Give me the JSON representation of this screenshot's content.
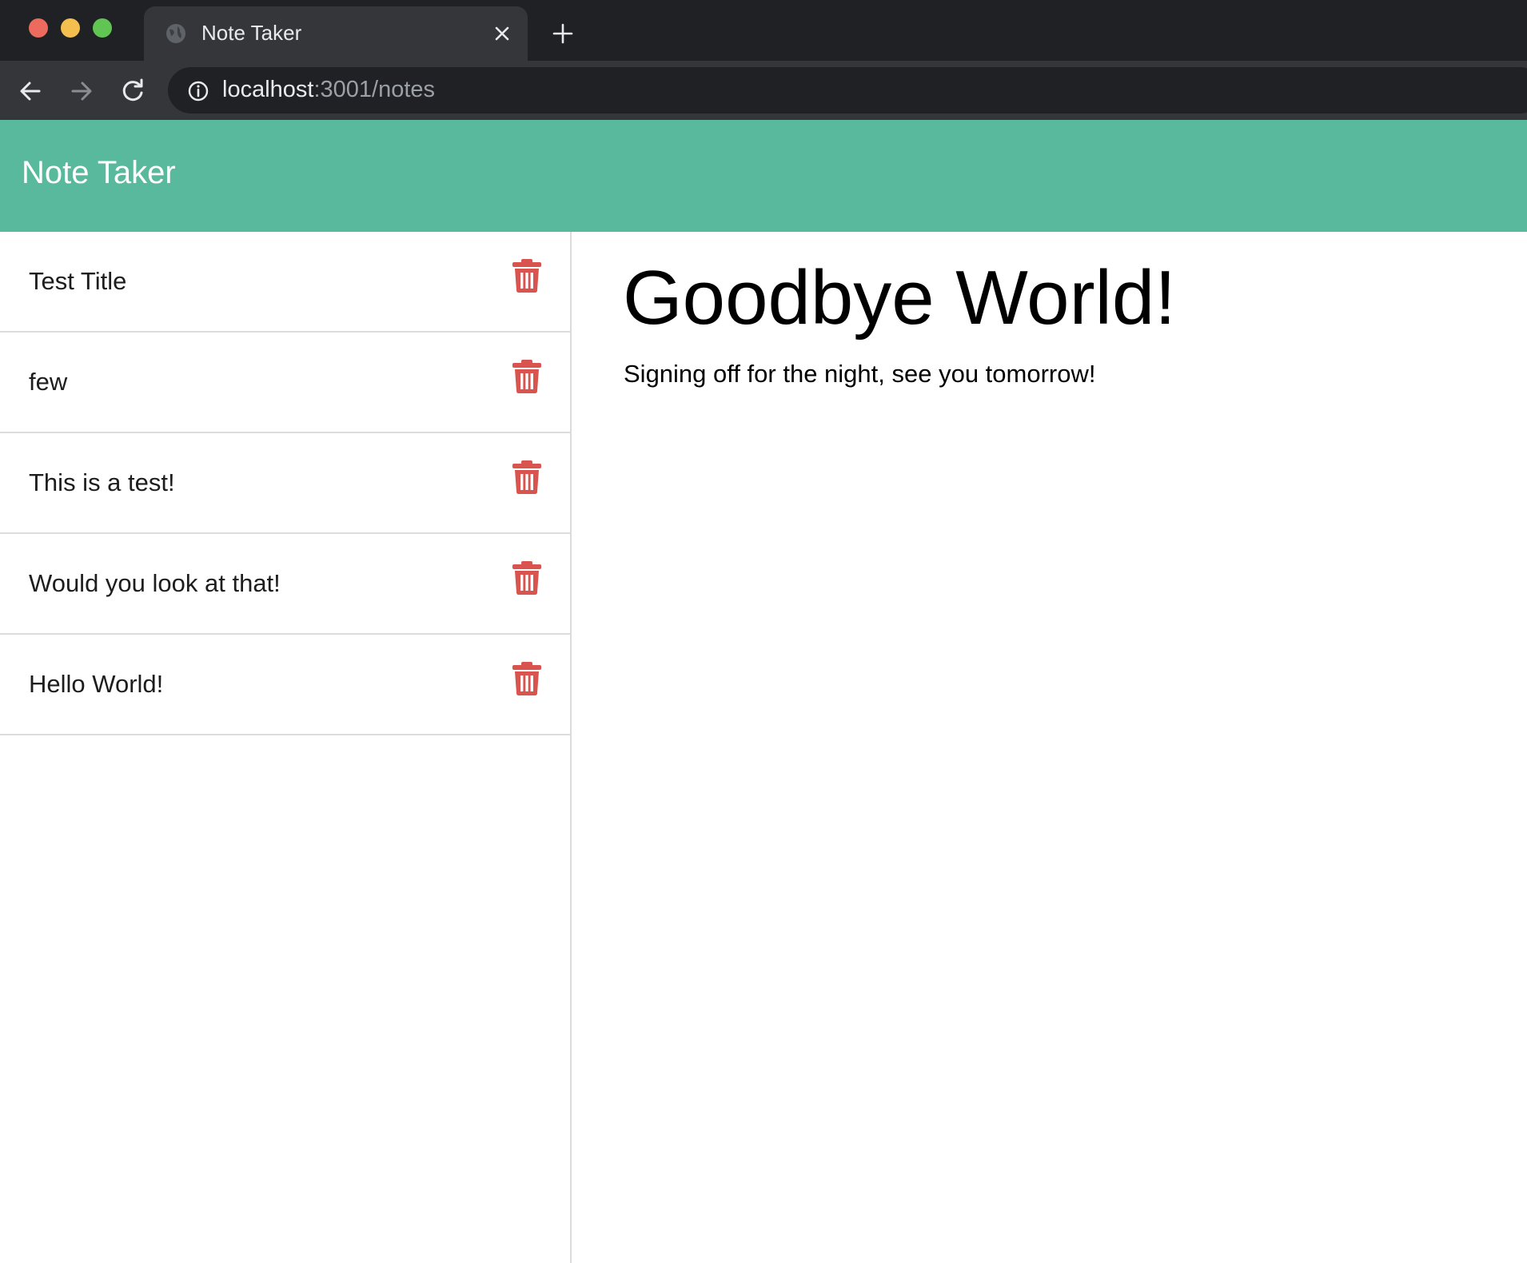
{
  "browser": {
    "tab_title": "Note Taker",
    "url_host": "localhost",
    "url_rest": ":3001/notes"
  },
  "app": {
    "title": "Note Taker",
    "accent_color": "#59b99c",
    "delete_icon_color": "#d9534f"
  },
  "notes": [
    {
      "title": "Test Title"
    },
    {
      "title": "few"
    },
    {
      "title": "This is a test!"
    },
    {
      "title": "Would you look at that!"
    },
    {
      "title": "Hello World!"
    }
  ],
  "active_note": {
    "title": "Goodbye World!",
    "text": "Signing off for the night, see you tomorrow!"
  }
}
